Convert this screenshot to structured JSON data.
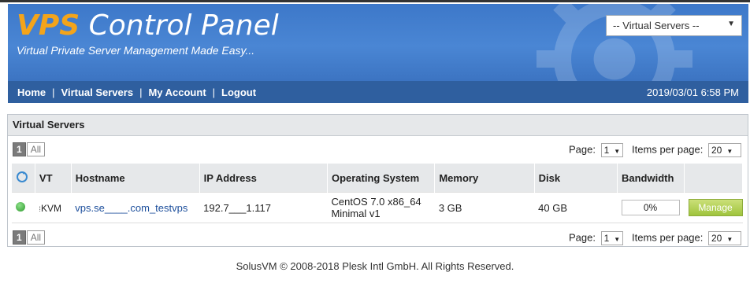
{
  "header": {
    "brand_vps": "VPS",
    "brand_rest": " Control Panel",
    "tagline": "Virtual Private Server Management Made Easy...",
    "server_select": "-- Virtual Servers --"
  },
  "nav": {
    "items": [
      "Home",
      "Virtual Servers",
      "My Account",
      "Logout"
    ],
    "separator": "|",
    "datetime": "2019/03/01 6:58 PM"
  },
  "panel": {
    "title": "Virtual Servers",
    "pager_current": "1",
    "pager_all": "All",
    "page_label": "Page:",
    "page_value": "1",
    "items_label": "Items per page:",
    "items_value": "20"
  },
  "table": {
    "headers": [
      "VT",
      "Hostname",
      "IP Address",
      "Operating System",
      "Memory",
      "Disk",
      "Bandwidth"
    ],
    "row": {
      "vt": "KVM",
      "hostname": "vps.se____.com_testvps",
      "ip": "192.7___1.117",
      "os_line1": "CentOS 7.0 x86_64",
      "os_line2": "Minimal v1",
      "memory": "3 GB",
      "disk": "40 GB",
      "bandwidth": "0%",
      "bandwidth_fraction": 0,
      "action": "Manage"
    }
  },
  "footer": {
    "text": "SolusVM © 2008-2018 Plesk Intl GmbH. All Rights Reserved."
  },
  "colors": {
    "header_blue": "#4a86d4",
    "nav_blue": "#2f5f9f",
    "brand_orange": "#f3a41b",
    "status_green": "#2c9a2c",
    "manage_green": "#9fc43c"
  },
  "icons": {
    "status": "status-online-dot",
    "vt": "kvm-icon",
    "refresh": "refresh-icon"
  }
}
